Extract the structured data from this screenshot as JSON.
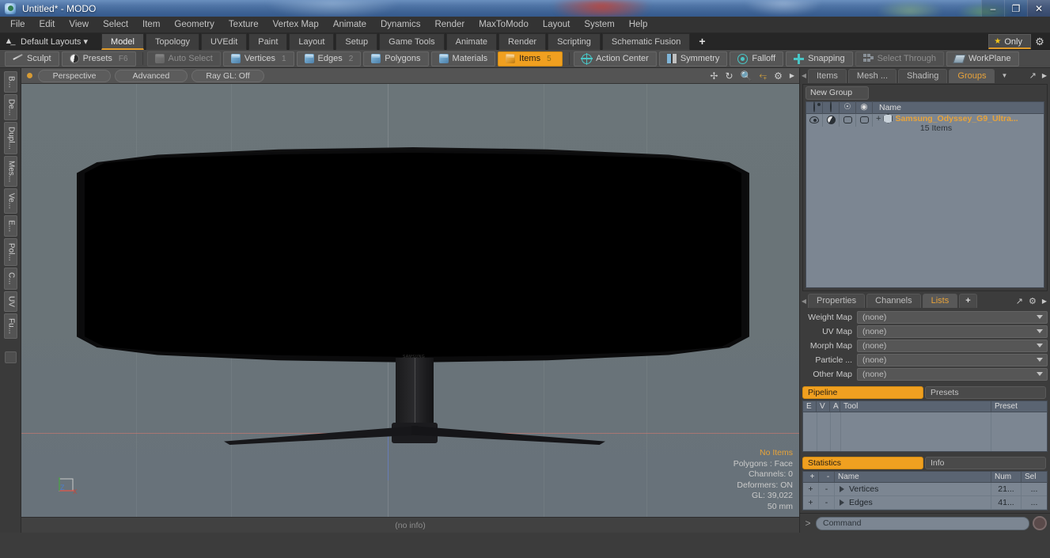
{
  "window": {
    "title": "Untitled* - MODO",
    "app_icon": "modo-logo-icon",
    "minimize": "–",
    "maximize": "❐",
    "close": "✕"
  },
  "menubar": {
    "items": [
      "File",
      "Edit",
      "View",
      "Select",
      "Item",
      "Geometry",
      "Texture",
      "Vertex Map",
      "Animate",
      "Dynamics",
      "Render",
      "MaxToModo",
      "Layout",
      "System",
      "Help"
    ]
  },
  "layoutbar": {
    "home_icon": "home-upload-icon",
    "layout_selector": "Default Layouts",
    "tabs": [
      {
        "label": "Model",
        "active": true
      },
      {
        "label": "Topology",
        "active": false
      },
      {
        "label": "UVEdit",
        "active": false
      },
      {
        "label": "Paint",
        "active": false
      },
      {
        "label": "Layout",
        "active": false
      },
      {
        "label": "Setup",
        "active": false
      },
      {
        "label": "Game Tools",
        "active": false
      },
      {
        "label": "Animate",
        "active": false
      },
      {
        "label": "Render",
        "active": false
      },
      {
        "label": "Scripting",
        "active": false
      },
      {
        "label": "Schematic Fusion",
        "active": false
      }
    ],
    "add_tab": "+",
    "only_button": "Only",
    "star_icon": "star-icon",
    "gear_icon": "gear-icon",
    "accent_color": "#e09b2a"
  },
  "modebar": {
    "sculpt": "Sculpt",
    "presets": "Presets",
    "presets_hotkey": "F6",
    "auto_select": "Auto Select",
    "vertices": "Vertices",
    "vertices_hotkey": "1",
    "edges": "Edges",
    "edges_hotkey": "2",
    "polygons": "Polygons",
    "materials": "Materials",
    "items": "Items",
    "items_hotkey": "5",
    "action_center": "Action Center",
    "symmetry": "Symmetry",
    "falloff": "Falloff",
    "snapping": "Snapping",
    "select_through": "Select Through",
    "workplane": "WorkPlane",
    "selected_mode": "Items",
    "selected_color": "#f0a020"
  },
  "lefttabs": {
    "items": [
      "B...",
      "De...",
      "Dupl...",
      "Mes...",
      "Ve...",
      "E...",
      "Pol...",
      "C...",
      "UV",
      "Fu..."
    ]
  },
  "viewport": {
    "header": {
      "dot": "viewport-active-dot",
      "view_mode": "Perspective",
      "shading": "Advanced",
      "raygl": "Ray GL: Off",
      "icons": [
        "pan-icon",
        "rotate-icon",
        "zoom-icon",
        "fit-icon",
        "gear-icon",
        "chevron-right-icon"
      ]
    },
    "model_logo": "SAMSUNG",
    "axis_gizmo": {
      "x": "X",
      "y": "Y",
      "z": "Z"
    },
    "stats": {
      "selection": "No Items",
      "polygons": "Polygons : Face",
      "channels": "Channels: 0",
      "deformers": "Deformers: ON",
      "gl": "GL: 39,022",
      "grid": "50 mm"
    }
  },
  "statusbar": {
    "info": "(no info)"
  },
  "right_panel": {
    "top_tabs": [
      {
        "label": "Items",
        "active": false
      },
      {
        "label": "Mesh ...",
        "active": false
      },
      {
        "label": "Shading",
        "active": false
      },
      {
        "label": "Groups",
        "active": true
      }
    ],
    "top_tabs_caret": "▼",
    "top_icons": [
      "expand-icon",
      "chevron-right-icon"
    ],
    "new_group_button": "New Group",
    "group_columns": [
      "eye-icon",
      "ghost-icon",
      "lock-icon",
      "render-icon",
      "Name"
    ],
    "group_name_header": "Name",
    "group_item": {
      "name": "Samsung_Odyssey_G9_Ultra...",
      "subtitle": "15 Items",
      "expand": "+",
      "type_icon": "group-hex-icon",
      "name_color": "#e8a33a"
    },
    "mid_tabs": [
      {
        "label": "Properties",
        "active": false
      },
      {
        "label": "Channels",
        "active": false
      },
      {
        "label": "Lists",
        "active": true
      },
      {
        "label": "+",
        "active": false
      }
    ],
    "mid_icons": [
      "expand-icon",
      "gear-icon",
      "chevron-right-icon"
    ],
    "lists": [
      {
        "label": "Weight Map",
        "value": "(none)"
      },
      {
        "label": "UV Map",
        "value": "(none)"
      },
      {
        "label": "Morph Map",
        "value": "(none)"
      },
      {
        "label": "Particle   ...",
        "value": "(none)"
      },
      {
        "label": "Other Map",
        "value": "(none)"
      }
    ],
    "pipeline": {
      "tab_active": "Pipeline",
      "tab_inactive": "Presets",
      "columns": [
        "E",
        "V",
        "A",
        "Tool",
        "Preset"
      ],
      "rows": []
    },
    "statistics": {
      "tab_active": "Statistics",
      "tab_inactive": "Info",
      "columns": [
        "+",
        "-",
        "Name",
        "Num",
        "Sel"
      ],
      "rows": [
        {
          "add": "+",
          "sub": "-",
          "name": "Vertices",
          "num": "21...",
          "sel": "..."
        },
        {
          "add": "+",
          "sub": "-",
          "name": "Edges",
          "num": "41...",
          "sel": "..."
        }
      ]
    },
    "command": {
      "prompt": ">",
      "placeholder": "Command",
      "record_icon": "record-icon"
    }
  }
}
